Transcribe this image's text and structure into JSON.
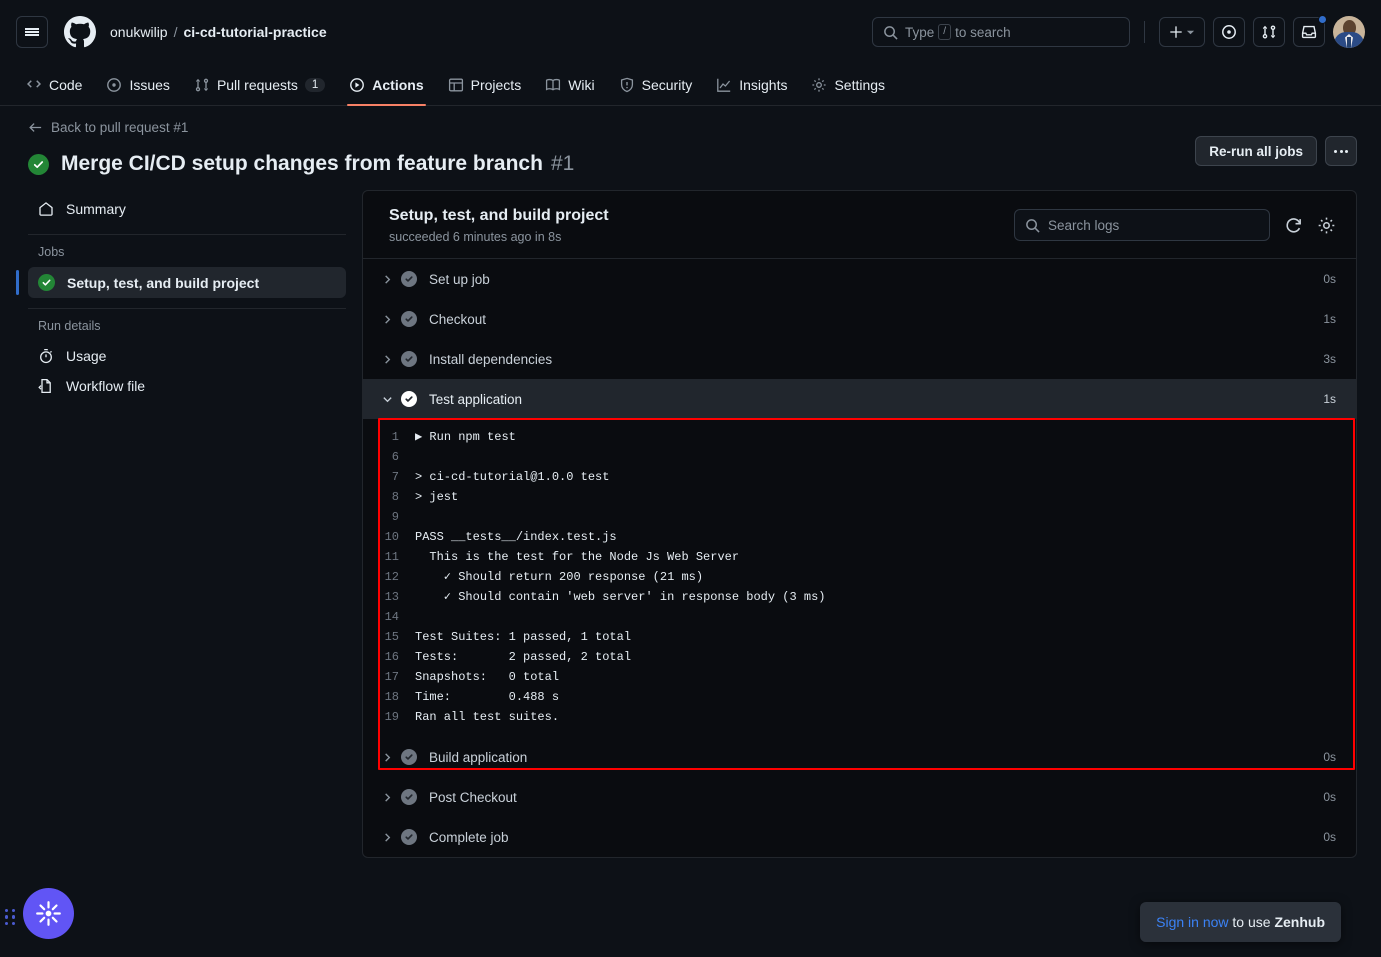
{
  "header": {
    "menu_icon": "hamburger-icon",
    "logo_icon": "github-logo-icon",
    "owner": "onukwilip",
    "separator": "/",
    "repo": "ci-cd-tutorial-practice",
    "search_placeholder_prefix": "Type",
    "search_key": "/",
    "search_placeholder_suffix": "to search",
    "create_new_label": "+",
    "issues_icon": "issue-opened-icon",
    "pull_requests_icon": "git-pull-request-icon",
    "inbox_icon": "inbox-icon",
    "avatar_label": "avatar"
  },
  "nav": {
    "tabs": [
      {
        "label": "Code",
        "icon": "code-icon",
        "active": false,
        "counter": null
      },
      {
        "label": "Issues",
        "icon": "issue-opened-icon",
        "active": false,
        "counter": null
      },
      {
        "label": "Pull requests",
        "icon": "git-pull-request-icon",
        "active": false,
        "counter": "1"
      },
      {
        "label": "Actions",
        "icon": "play-icon",
        "active": true,
        "counter": null
      },
      {
        "label": "Projects",
        "icon": "table-icon",
        "active": false,
        "counter": null
      },
      {
        "label": "Wiki",
        "icon": "book-icon",
        "active": false,
        "counter": null
      },
      {
        "label": "Security",
        "icon": "shield-icon",
        "active": false,
        "counter": null
      },
      {
        "label": "Insights",
        "icon": "graph-icon",
        "active": false,
        "counter": null
      },
      {
        "label": "Settings",
        "icon": "gear-icon",
        "active": false,
        "counter": null
      }
    ]
  },
  "title": {
    "back_label": "Back to pull request #1",
    "status_icon": "check-circle-icon",
    "run_name": "Merge CI/CD setup changes from feature branch",
    "run_number": "#1",
    "rerun_label": "Re-run all jobs",
    "kebab_label": "More options"
  },
  "sidebar": {
    "summary": {
      "label": "Summary",
      "icon": "home-icon"
    },
    "jobs_heading": "Jobs",
    "jobs": [
      {
        "label": "Setup, test, and build project",
        "icon": "check-circle-icon",
        "selected": true
      }
    ],
    "run_details_heading": "Run details",
    "run_details": [
      {
        "label": "Usage",
        "icon": "stopwatch-icon"
      },
      {
        "label": "Workflow file",
        "icon": "file-code-icon"
      }
    ]
  },
  "job": {
    "title": "Setup, test, and build project",
    "subtitle": "succeeded 6 minutes ago in 8s",
    "search_placeholder": "Search logs",
    "refresh_icon": "refresh-icon",
    "settings_icon": "gear-icon",
    "steps": [
      {
        "name": "Set up job",
        "duration": "0s",
        "expanded": false,
        "status": "success"
      },
      {
        "name": "Checkout",
        "duration": "1s",
        "expanded": false,
        "status": "success"
      },
      {
        "name": "Install dependencies",
        "duration": "3s",
        "expanded": false,
        "status": "success"
      },
      {
        "name": "Test application",
        "duration": "1s",
        "expanded": true,
        "status": "success"
      },
      {
        "name": "Build application",
        "duration": "0s",
        "expanded": false,
        "status": "success"
      },
      {
        "name": "Post Checkout",
        "duration": "0s",
        "expanded": false,
        "status": "success"
      },
      {
        "name": "Complete job",
        "duration": "0s",
        "expanded": false,
        "status": "success"
      }
    ],
    "log_lines": [
      {
        "num": "1",
        "text": "▶ Run npm test"
      },
      {
        "num": "6",
        "text": ""
      },
      {
        "num": "7",
        "text": "> ci-cd-tutorial@1.0.0 test"
      },
      {
        "num": "8",
        "text": "> jest"
      },
      {
        "num": "9",
        "text": ""
      },
      {
        "num": "10",
        "text": "PASS __tests__/index.test.js"
      },
      {
        "num": "11",
        "text": "  This is the test for the Node Js Web Server"
      },
      {
        "num": "12",
        "text": "    ✓ Should return 200 response (21 ms)"
      },
      {
        "num": "13",
        "text": "    ✓ Should contain 'web server' in response body (3 ms)"
      },
      {
        "num": "14",
        "text": ""
      },
      {
        "num": "15",
        "text": "Test Suites: 1 passed, 1 total"
      },
      {
        "num": "16",
        "text": "Tests:       2 passed, 2 total"
      },
      {
        "num": "17",
        "text": "Snapshots:   0 total"
      },
      {
        "num": "18",
        "text": "Time:        0.488 s"
      },
      {
        "num": "19",
        "text": "Ran all test suites."
      }
    ]
  },
  "zenhub": {
    "toast_link": "Sign in now",
    "toast_middle": " to use ",
    "toast_brand": "Zenhub",
    "fab_icon": "zenhub-logo-icon",
    "drag_handle": "drag-handle-icon"
  },
  "annotation": {
    "color": "#ff0000",
    "target_step": "Test application"
  }
}
